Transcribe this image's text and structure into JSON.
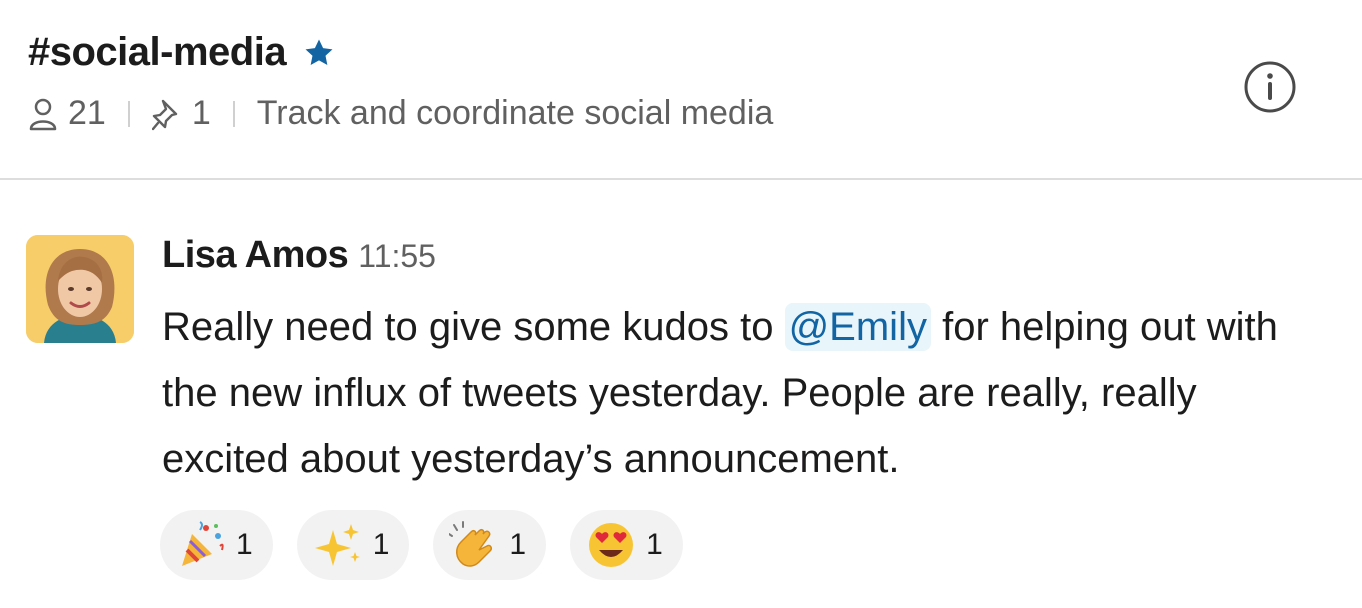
{
  "header": {
    "channel_name": "#social-media",
    "member_count": "21",
    "pinned_count": "1",
    "topic": "Track and coordinate social media"
  },
  "message": {
    "author": "Lisa Amos",
    "time": "11:55",
    "text_before": "Really need to give some kudos to ",
    "mention": "@Emily",
    "text_after": " for helping out with the new influx of tweets yesterday. People are really, really excited about yesterday’s announcement."
  },
  "reactions": [
    {
      "icon": "party-popper-icon",
      "count": "1"
    },
    {
      "icon": "sparkles-icon",
      "count": "1"
    },
    {
      "icon": "clapping-hands-icon",
      "count": "1"
    },
    {
      "icon": "heart-eyes-icon",
      "count": "1"
    }
  ],
  "colors": {
    "star": "#1264a3",
    "mention": "#1264a3",
    "mention_bg": "#e8f5fa",
    "reaction_bg": "#f2f2f2",
    "avatar_bg": "#f7cd6a"
  }
}
